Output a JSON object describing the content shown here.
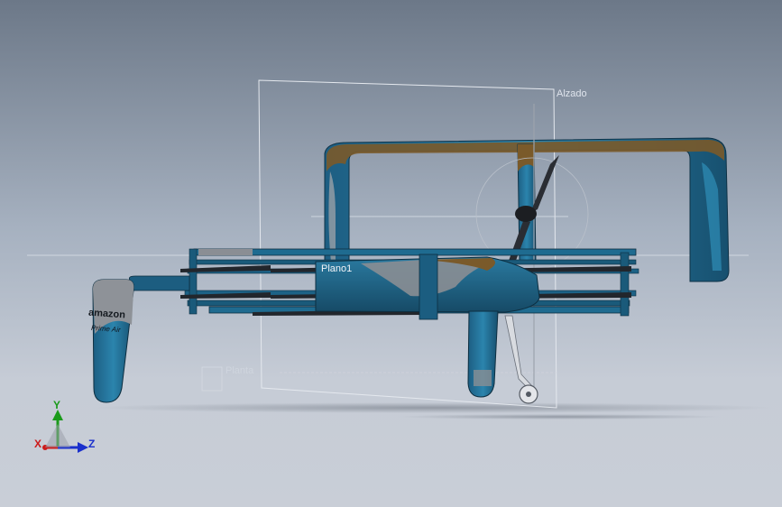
{
  "viewport": {
    "background_top": "#6c7888",
    "background_bottom": "#c9ced7"
  },
  "planes": {
    "front": "Alzado",
    "plane1": "Plano1",
    "top": "Planta"
  },
  "model": {
    "brand_text": "amazon",
    "sub_text": "Prime Air",
    "body_color": "#1e5f80",
    "accent_color": "#7a5a2a",
    "panel_color": "#8a8e94"
  },
  "triad": {
    "y_label": "Y",
    "x_label": "X",
    "z_label": "Z",
    "x_color": "#cc1a1a",
    "y_color": "#1a9a1a",
    "z_color": "#1a2fcc"
  }
}
